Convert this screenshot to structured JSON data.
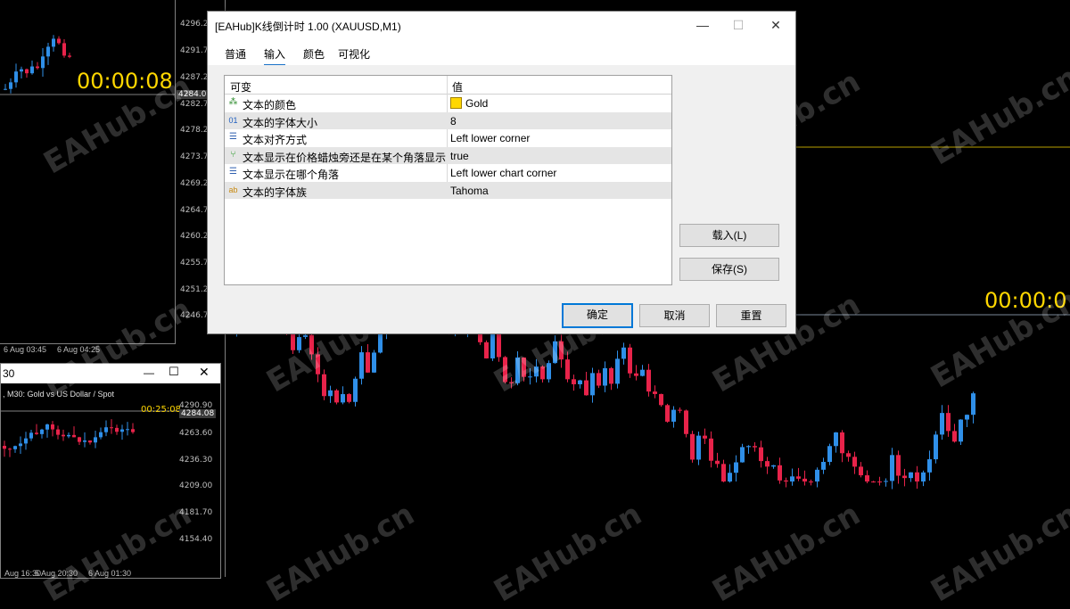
{
  "chart_left": {
    "price_ticks": [
      "4296.20",
      "4291.70",
      "4287.20",
      "4282.70",
      "4278.20",
      "4273.70",
      "4269.20",
      "4264.70",
      "4260.20",
      "4255.70",
      "4251.20",
      "4246.70"
    ],
    "current_price": "4284.08",
    "timer": "00:00:08",
    "time_labels": [
      "6 Aug 03:45",
      "6 Aug 04:25"
    ]
  },
  "chart_small": {
    "window_num": "30",
    "header": ", M30:  Gold vs US Dollar / Spot",
    "price_ticks": [
      "4290.90",
      "4263.60",
      "4236.30",
      "4209.00",
      "4181.70",
      "4154.40"
    ],
    "current_price": "4284.08",
    "timer": "00:25:08",
    "time_labels": [
      "Aug 16:30",
      "5 Aug 20:30",
      "6 Aug 01:30"
    ]
  },
  "chart_main": {
    "timer": "00:00:0"
  },
  "watermark": "EAHub.cn",
  "dialog": {
    "title": "[EAHub]K线倒计时 1.00 (XAUUSD,M1)",
    "tabs": [
      "普通",
      "输入",
      "颜色",
      "可视化"
    ],
    "active_tab": "输入",
    "columns": {
      "variable": "可变",
      "value": "值"
    },
    "params": [
      {
        "icon": "color-icon",
        "name": "文本的颜色",
        "value": "Gold"
      },
      {
        "icon": "int-icon",
        "name": "文本的字体大小",
        "value": "8"
      },
      {
        "icon": "enum-icon",
        "name": "文本对齐方式",
        "value": "Left lower corner"
      },
      {
        "icon": "bool-icon",
        "name": "文本显示在价格蜡烛旁还是在某个角落显示",
        "value": "true"
      },
      {
        "icon": "enum-icon",
        "name": "文本显示在哪个角落",
        "value": "Left lower chart corner"
      },
      {
        "icon": "string-icon",
        "name": "文本的字体族",
        "value": "Tahoma"
      }
    ],
    "buttons": {
      "load": "载入(L)",
      "save": "保存(S)",
      "ok": "确定",
      "cancel": "取消",
      "reset": "重置"
    },
    "gold_color": "#ffd700"
  }
}
